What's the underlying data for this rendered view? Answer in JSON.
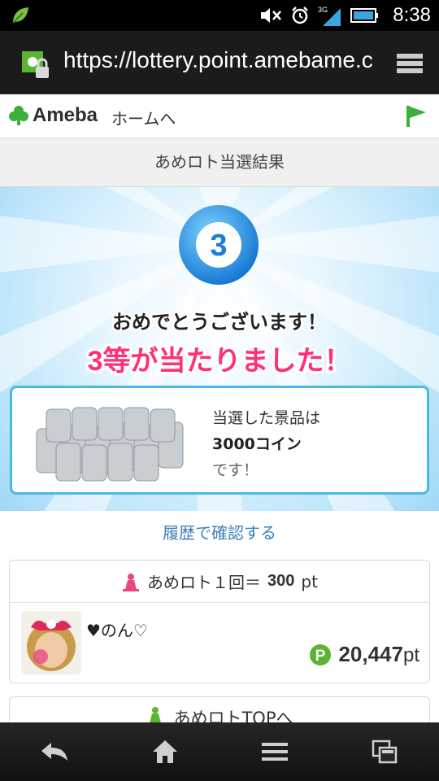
{
  "status_bar": {
    "time": "8:38",
    "network": "3G"
  },
  "browser": {
    "url": "https://lottery.point.amebame.c"
  },
  "header": {
    "logo_text": "Ameba",
    "home_link": "ホームへ"
  },
  "page_title": "あめロト当選結果",
  "result": {
    "ball_number": "3",
    "congrats": "おめでとうございます！",
    "won_message": "3等が当たりました！",
    "prize_line1": "当選した景品は",
    "prize_value": "3000コイン",
    "prize_line3": "です！"
  },
  "history_link": "履歴で確認する",
  "cost_card": {
    "label": "あめロト１回＝",
    "value": "300",
    "unit": "pt"
  },
  "user": {
    "name": "♥のん♡",
    "points": "20,447",
    "points_unit": "pt"
  },
  "top_link": {
    "label": "あめロトTOPへ"
  },
  "colors": {
    "accent_blue": "#4cb8e8",
    "won_pink": "#ff2f78",
    "link_blue": "#3d7fb8",
    "point_green": "#5bb531"
  }
}
